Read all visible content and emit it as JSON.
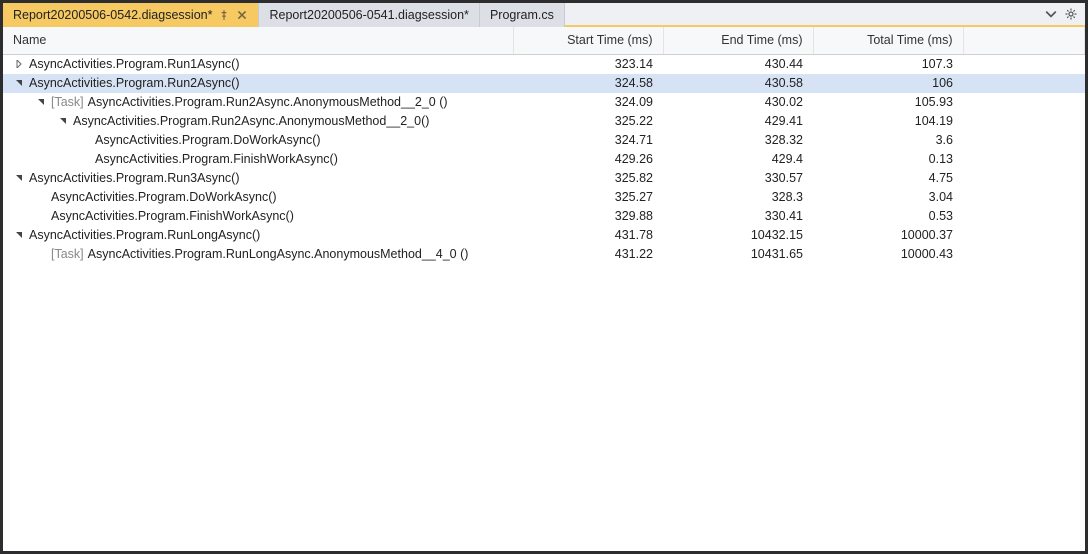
{
  "tabs": [
    {
      "label": "Report20200506-0542.diagsession*",
      "active": true,
      "pinned": true,
      "closeable": true
    },
    {
      "label": "Report20200506-0541.diagsession*",
      "active": false,
      "pinned": false,
      "closeable": false
    },
    {
      "label": "Program.cs",
      "active": false,
      "pinned": false,
      "closeable": false
    }
  ],
  "columns": {
    "name": "Name",
    "start": "Start Time (ms)",
    "end": "End Time (ms)",
    "total": "Total Time (ms)"
  },
  "task_prefix": "[Task]",
  "rows": [
    {
      "depth": 0,
      "expander": "collapsed",
      "selected": false,
      "name": "AsyncActivities.Program.Run1Async()",
      "task": false,
      "start": "323.14",
      "end": "430.44",
      "total": "107.3"
    },
    {
      "depth": 0,
      "expander": "expanded",
      "selected": true,
      "name": "AsyncActivities.Program.Run2Async()",
      "task": false,
      "start": "324.58",
      "end": "430.58",
      "total": "106"
    },
    {
      "depth": 1,
      "expander": "expanded",
      "selected": false,
      "name": "AsyncActivities.Program.Run2Async.AnonymousMethod__2_0 ()",
      "task": true,
      "start": "324.09",
      "end": "430.02",
      "total": "105.93"
    },
    {
      "depth": 2,
      "expander": "expanded",
      "selected": false,
      "name": "AsyncActivities.Program.Run2Async.AnonymousMethod__2_0()",
      "task": false,
      "start": "325.22",
      "end": "429.41",
      "total": "104.19"
    },
    {
      "depth": 3,
      "expander": "none",
      "selected": false,
      "name": "AsyncActivities.Program.DoWorkAsync()",
      "task": false,
      "start": "324.71",
      "end": "328.32",
      "total": "3.6"
    },
    {
      "depth": 3,
      "expander": "none",
      "selected": false,
      "name": "AsyncActivities.Program.FinishWorkAsync()",
      "task": false,
      "start": "429.26",
      "end": "429.4",
      "total": "0.13"
    },
    {
      "depth": 0,
      "expander": "expanded",
      "selected": false,
      "name": "AsyncActivities.Program.Run3Async()",
      "task": false,
      "start": "325.82",
      "end": "330.57",
      "total": "4.75"
    },
    {
      "depth": 1,
      "expander": "none",
      "selected": false,
      "name": "AsyncActivities.Program.DoWorkAsync()",
      "task": false,
      "start": "325.27",
      "end": "328.3",
      "total": "3.04"
    },
    {
      "depth": 1,
      "expander": "none",
      "selected": false,
      "name": "AsyncActivities.Program.FinishWorkAsync()",
      "task": false,
      "start": "329.88",
      "end": "330.41",
      "total": "0.53"
    },
    {
      "depth": 0,
      "expander": "expanded",
      "selected": false,
      "name": "AsyncActivities.Program.RunLongAsync()",
      "task": false,
      "start": "431.78",
      "end": "10432.15",
      "total": "10000.37"
    },
    {
      "depth": 1,
      "expander": "none",
      "selected": false,
      "name": "AsyncActivities.Program.RunLongAsync.AnonymousMethod__4_0 ()",
      "task": true,
      "start": "431.22",
      "end": "10431.65",
      "total": "10000.43"
    }
  ]
}
